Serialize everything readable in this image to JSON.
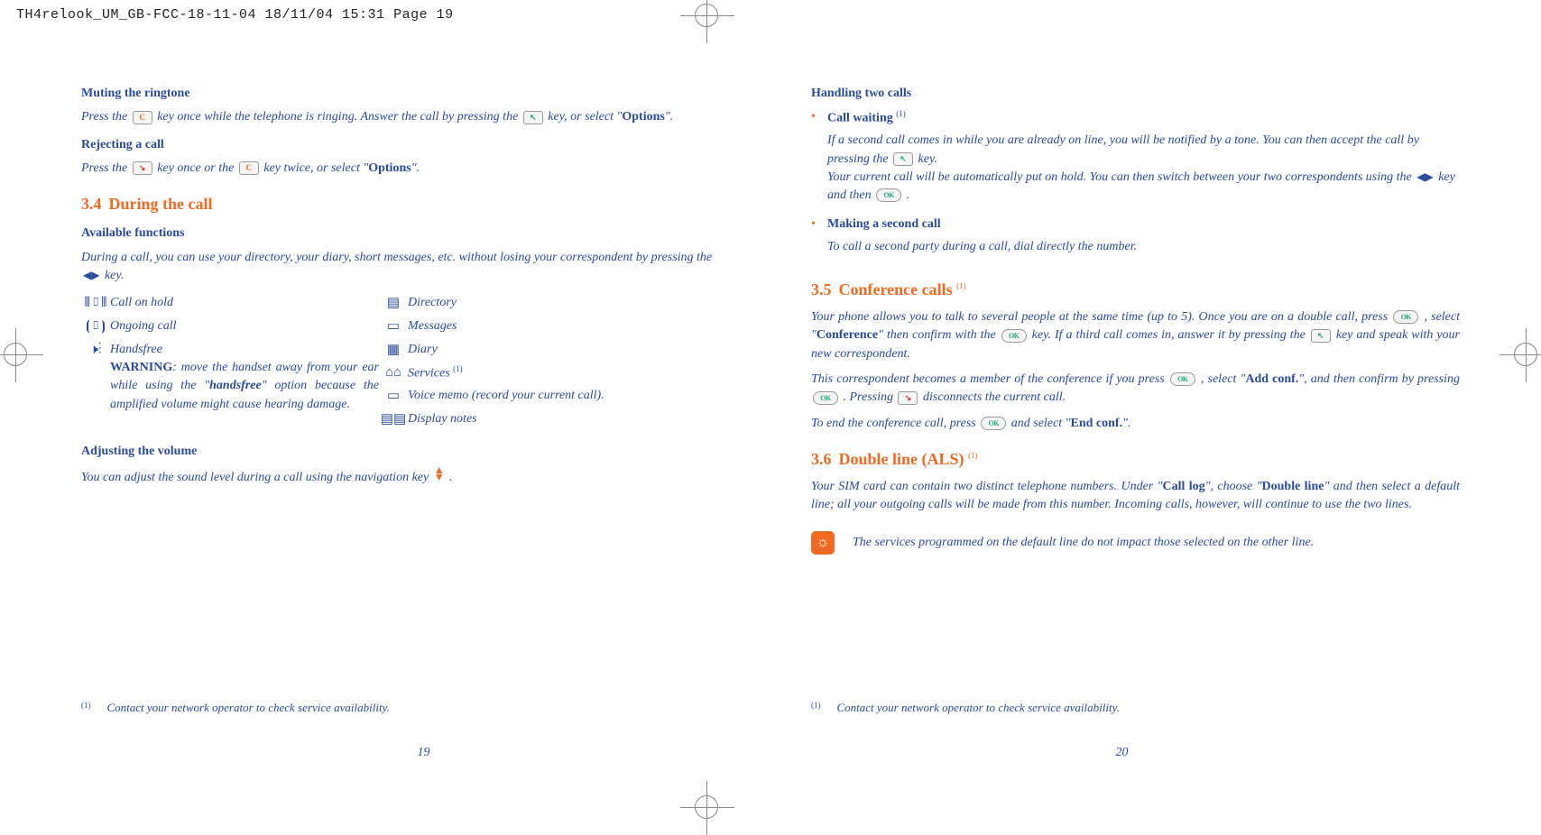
{
  "print_header": "TH4relook_UM_GB-FCC-18-11-04  18/11/04  15:31  Page 19",
  "left": {
    "h_muting": "Muting the ringtone",
    "p_muting_a": "Press the ",
    "p_muting_b": " key once while the telephone is ringing. Answer the call by pressing the ",
    "p_muting_c": " key, or select \"",
    "p_muting_bold": "Options",
    "p_muting_d": "\".",
    "h_reject": "Rejecting a call",
    "p_reject_a": "Press the ",
    "p_reject_b": " key once or the ",
    "p_reject_c": " key twice, or select \"",
    "p_reject_bold": "Options",
    "p_reject_d": "\".",
    "sec34_num": "3.4",
    "sec34_title": "During the call",
    "h_avail": "Available functions",
    "p_avail_a": "During a call, you can use your directory, your diary, short messages, etc. without losing your correspondent by pressing the ",
    "p_avail_b": " key.",
    "func_hold": "Call on hold",
    "func_ongoing": "Ongoing call",
    "func_hf": "Handsfree",
    "func_hf_warn": "WARNING",
    "func_hf_text_a": ": move the handset away from your ear while using the \"",
    "func_hf_text_bold": "handsfree",
    "func_hf_text_b": "\" option because the amplified volume might cause hearing damage.",
    "func_dir": "Directory",
    "func_msg": "Messages",
    "func_diary": "Diary",
    "func_serv": "Services ",
    "func_serv_sup": "(1)",
    "func_voice": "Voice memo (record your current call).",
    "func_notes": "Display notes",
    "h_volume": "Adjusting the volume",
    "p_volume_a": "You can adjust the sound level during a call using the navigation key ",
    "p_volume_b": ".",
    "footnote_mark": "(1)",
    "footnote": "Contact your network operator to check service availability.",
    "pagenum": "19"
  },
  "right": {
    "h_two": "Handling two calls",
    "cw_title": "Call waiting ",
    "cw_sup": "(1)",
    "cw_a": "If a second call comes in while you are already on line, you will be notified by a tone. You can then accept the call by pressing the ",
    "cw_b": " key.",
    "cw_c": "Your current call will be automatically put on hold. You can then switch between your two correspondents using the ",
    "cw_d": " key and then ",
    "cw_e": ".",
    "msc_title": "Making a second call",
    "msc_a": "To call a second party during a call, dial directly the number.",
    "sec35_num": "3.5",
    "sec35_title": "Conference calls ",
    "sec35_sup": "(1)",
    "conf_a1": "Your phone allows you to talk to several people at the same time (up to 5). Once you are on a double call, press ",
    "conf_a2": ", select \"",
    "conf_a_bold": "Conference",
    "conf_a3": "\" then confirm with the ",
    "conf_a4": " key. If a third call comes in, answer it by pressing the ",
    "conf_a5": " key and speak with your new correspondent.",
    "conf_b1": "This correspondent becomes a member of the conference if you press ",
    "conf_b2": ", select \"",
    "conf_b_bold": "Add conf.",
    "conf_b3": "\", and then confirm by pressing ",
    "conf_b4": ". Pressing ",
    "conf_b5": " disconnects the current call.",
    "conf_c1": "To end the conference call, press ",
    "conf_c2": " and select \"",
    "conf_c_bold": "End conf.",
    "conf_c3": "\".",
    "sec36_num": "3.6",
    "sec36_title": "Double line (ALS) ",
    "sec36_sup": "(1)",
    "dl_a1": "Your SIM card can contain two distinct telephone numbers. Under \"",
    "dl_a_bold1": "Call log",
    "dl_a2": "\", choose \"",
    "dl_a_bold2": "Double line",
    "dl_a3": "\" and then select a default line; all your outgoing calls will be made from this number. Incoming calls, however, will continue to use the two lines.",
    "tip": "The services programmed on the default line do not impact those selected on the other line.",
    "footnote_mark": "(1)",
    "footnote": "Contact your network operator to check service availability.",
    "pagenum": "20"
  }
}
